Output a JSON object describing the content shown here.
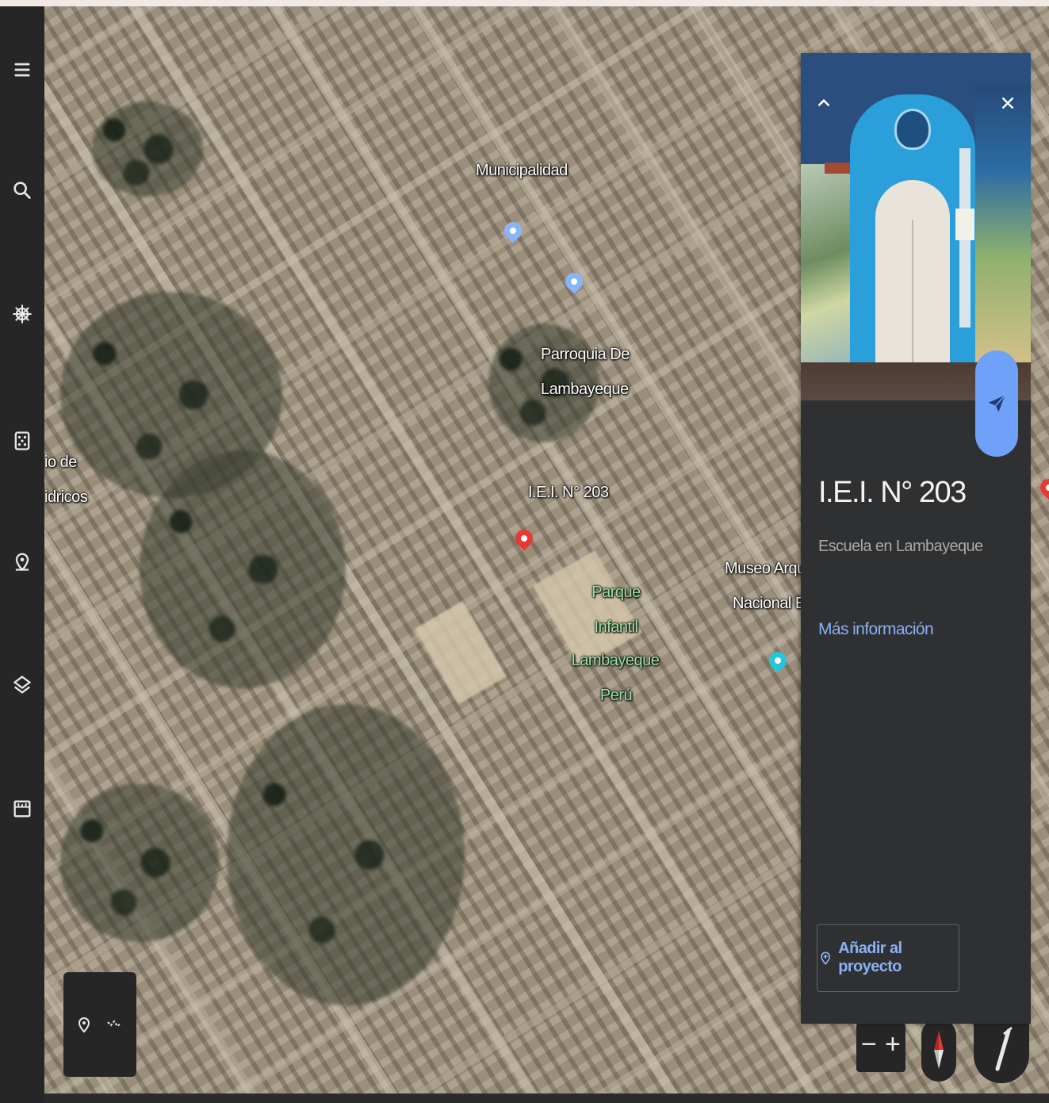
{
  "toolbar": {
    "items": [
      {
        "name": "menu",
        "icon": "menu-icon"
      },
      {
        "name": "search",
        "icon": "search-icon"
      },
      {
        "name": "voyager",
        "icon": "voyager-wheel-icon"
      },
      {
        "name": "feeling-lucky",
        "icon": "dice-icon"
      },
      {
        "name": "projects",
        "icon": "projects-pin-icon"
      },
      {
        "name": "map-style",
        "icon": "layers-icon"
      },
      {
        "name": "measure",
        "icon": "ruler-icon"
      }
    ]
  },
  "map": {
    "labels": {
      "municipalidad": "Municipalidad",
      "parroquia_line1": "Parroquia De",
      "parroquia_line2": "Lambayeque",
      "iei": "I.E.I. N° 203",
      "museo_line1": "Museo Arqueol",
      "museo_line2": "Nacional Brü",
      "parque_line1": "Parque",
      "parque_line2": "Infantil",
      "parque_line3": "Lambayeque",
      "parque_line4": "Perú",
      "left_line1": "io de",
      "left_line2": "idricos"
    },
    "colors": {
      "selected_pin": "#e53935",
      "poi_pin": "#8ab4f8",
      "museum_pin": "#26c6da",
      "park_label": "#9be2a4"
    }
  },
  "info_panel": {
    "title": "I.E.I. N° 203",
    "subtitle": "Escuela en Lambayeque",
    "more_info": "Más información",
    "add_to_project": "Añadir al proyecto",
    "collapse_icon": "chevron-up-icon",
    "close_icon": "close-icon",
    "share_icon": "share-send-icon",
    "accent": "#6ea1f7"
  },
  "controls": {
    "zoom_out": "−",
    "zoom_in": "+",
    "compass_icon": "compass-icon",
    "tilt_icon": "tilt-2d-3d-icon",
    "pegman_icon": "location-pin-icon",
    "path_icon": "path-icon"
  }
}
